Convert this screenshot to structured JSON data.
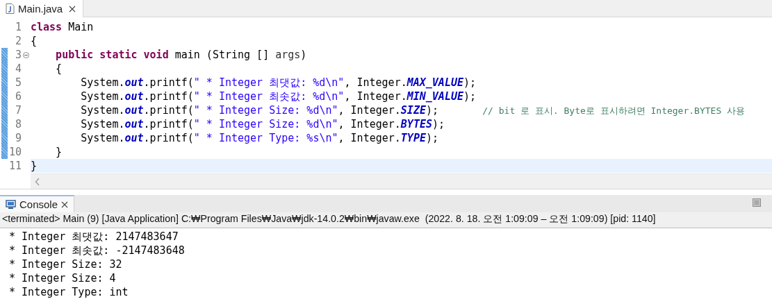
{
  "editor_tabs": [
    {
      "label": "Main.java",
      "selected": true
    }
  ],
  "code_lines": [
    {
      "number": "1",
      "changed": false,
      "fold": false,
      "current": false,
      "tokens": [
        {
          "kind": "keyword",
          "text": "class"
        },
        {
          "kind": "plain",
          "text": " Main"
        }
      ]
    },
    {
      "number": "2",
      "changed": false,
      "fold": false,
      "current": false,
      "tokens": [
        {
          "kind": "plain",
          "text": "{"
        }
      ]
    },
    {
      "number": "3",
      "changed": true,
      "fold": true,
      "current": false,
      "tokens": [
        {
          "kind": "keyword",
          "text": "    public "
        },
        {
          "kind": "keyword",
          "text": "static "
        },
        {
          "kind": "keyword",
          "text": "void"
        },
        {
          "kind": "plain",
          "text": " main (String [] "
        },
        {
          "kind": "param",
          "text": "args"
        },
        {
          "kind": "plain",
          "text": ")"
        }
      ]
    },
    {
      "number": "4",
      "changed": true,
      "fold": false,
      "current": false,
      "tokens": [
        {
          "kind": "plain",
          "text": "    {"
        }
      ]
    },
    {
      "number": "5",
      "changed": true,
      "fold": false,
      "current": false,
      "tokens": [
        {
          "kind": "plain",
          "text": "        System."
        },
        {
          "kind": "field",
          "text": "out"
        },
        {
          "kind": "plain",
          "text": ".printf("
        },
        {
          "kind": "string",
          "text": "\" * Integer 최댓값: %d\\n\""
        },
        {
          "kind": "plain",
          "text": ", Integer."
        },
        {
          "kind": "field",
          "text": "MAX_VALUE"
        },
        {
          "kind": "plain",
          "text": ");"
        }
      ]
    },
    {
      "number": "6",
      "changed": true,
      "fold": false,
      "current": false,
      "tokens": [
        {
          "kind": "plain",
          "text": "        System."
        },
        {
          "kind": "field",
          "text": "out"
        },
        {
          "kind": "plain",
          "text": ".printf("
        },
        {
          "kind": "string",
          "text": "\" * Integer 최솟값: %d\\n\""
        },
        {
          "kind": "plain",
          "text": ", Integer."
        },
        {
          "kind": "field",
          "text": "MIN_VALUE"
        },
        {
          "kind": "plain",
          "text": ");"
        }
      ]
    },
    {
      "number": "7",
      "changed": true,
      "fold": false,
      "current": false,
      "tokens": [
        {
          "kind": "plain",
          "text": "        System."
        },
        {
          "kind": "field",
          "text": "out"
        },
        {
          "kind": "plain",
          "text": ".printf("
        },
        {
          "kind": "string",
          "text": "\" * Integer Size: %d\\n\""
        },
        {
          "kind": "plain",
          "text": ", Integer."
        },
        {
          "kind": "field",
          "text": "SIZE"
        },
        {
          "kind": "plain",
          "text": ");       "
        },
        {
          "kind": "comment",
          "text": "// bit 로 표시. Byte로 표시하려면 Integer.BYTES 사용"
        }
      ]
    },
    {
      "number": "8",
      "changed": true,
      "fold": false,
      "current": false,
      "tokens": [
        {
          "kind": "plain",
          "text": "        System."
        },
        {
          "kind": "field",
          "text": "out"
        },
        {
          "kind": "plain",
          "text": ".printf("
        },
        {
          "kind": "string",
          "text": "\" * Integer Size: %d\\n\""
        },
        {
          "kind": "plain",
          "text": ", Integer."
        },
        {
          "kind": "field",
          "text": "BYTES"
        },
        {
          "kind": "plain",
          "text": ");"
        }
      ]
    },
    {
      "number": "9",
      "changed": true,
      "fold": false,
      "current": false,
      "tokens": [
        {
          "kind": "plain",
          "text": "        System."
        },
        {
          "kind": "field",
          "text": "out"
        },
        {
          "kind": "plain",
          "text": ".printf("
        },
        {
          "kind": "string",
          "text": "\" * Integer Type: %s\\n\""
        },
        {
          "kind": "plain",
          "text": ", Integer."
        },
        {
          "kind": "field",
          "text": "TYPE"
        },
        {
          "kind": "plain",
          "text": ");"
        }
      ]
    },
    {
      "number": "10",
      "changed": true,
      "fold": false,
      "current": false,
      "tokens": [
        {
          "kind": "plain",
          "text": "    }"
        }
      ]
    },
    {
      "number": "11",
      "changed": false,
      "fold": false,
      "current": true,
      "tokens": [
        {
          "kind": "plain",
          "text": "}"
        }
      ]
    }
  ],
  "console": {
    "tabs": [
      {
        "label": "Console",
        "selected": true
      }
    ],
    "header": "<terminated> Main (9) [Java Application] C:₩Program Files₩Java₩jdk-14.0.2₩bin₩javaw.exe  (2022. 8. 18. 오전 1:09:09 – 오전 1:09:09) [pid: 1140]",
    "output": [
      " * Integer 최댓값: 2147483647",
      " * Integer 최솟값: -2147483648",
      " * Integer Size: 32",
      " * Integer Size: 4",
      " * Integer Type: int"
    ]
  }
}
